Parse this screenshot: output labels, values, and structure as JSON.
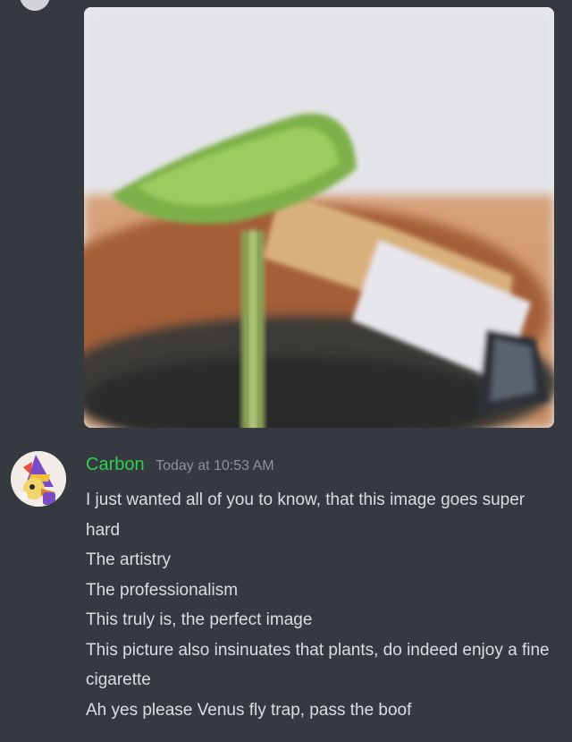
{
  "message": {
    "author": "Carbon",
    "timestamp": "Today at 10:53 AM",
    "lines": [
      "I just wanted all of you to know, that this image goes super hard",
      "The artistry",
      "The professionalism",
      "This truly is, the perfect image",
      "This picture also insinuates that plants, do indeed enjoy a fine cigarette",
      "Ah yes please Venus fly trap, pass the boof"
    ]
  },
  "colors": {
    "background": "#36393f",
    "username": "#2fd14f",
    "timestamp": "#8e9297",
    "text": "#dcddde"
  },
  "icons": {
    "avatar": "wizard-character-avatar",
    "attachment": "plant-with-cigarette-photo"
  }
}
